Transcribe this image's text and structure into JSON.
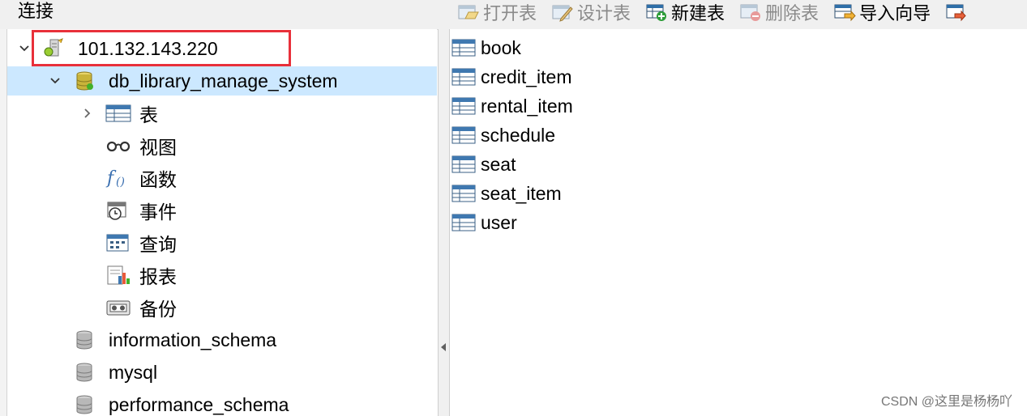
{
  "left_panel": {
    "title": "连接"
  },
  "toolbar": {
    "open_table": "打开表",
    "design_table": "设计表",
    "new_table": "新建表",
    "delete_table": "删除表",
    "import_wizard": "导入向导"
  },
  "tree": {
    "connection": "101.132.143.220",
    "database": "db_library_manage_system",
    "categories": {
      "tables": "表",
      "views": "视图",
      "functions": "函数",
      "events": "事件",
      "queries": "查询",
      "reports": "报表",
      "backups": "备份"
    },
    "other_databases": [
      "information_schema",
      "mysql",
      "performance_schema"
    ]
  },
  "tables": [
    "book",
    "credit_item",
    "rental_item",
    "schedule",
    "seat",
    "seat_item",
    "user"
  ],
  "watermark": "CSDN @这里是杨杨吖",
  "colors": {
    "selected_row": "#cce8ff",
    "highlight_box": "#e8303a",
    "panel_bg": "#f0f0f0"
  }
}
